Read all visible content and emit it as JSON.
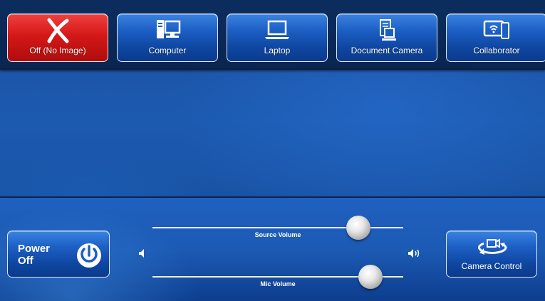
{
  "sources": [
    {
      "label": "Off (No Image)",
      "icon": "x-icon",
      "active": true
    },
    {
      "label": "Computer",
      "icon": "computer-icon",
      "active": false
    },
    {
      "label": "Laptop",
      "icon": "laptop-icon",
      "active": false
    },
    {
      "label": "Document Camera",
      "icon": "document-camera-icon",
      "active": false
    },
    {
      "label": "Collaborator",
      "icon": "collaborator-icon",
      "active": false
    }
  ],
  "power": {
    "label": "Power Off",
    "icon": "power-icon"
  },
  "camera": {
    "label": "Camera Control",
    "icon": "camera-rotate-icon"
  },
  "source_volume": {
    "label": "Source Volume",
    "level": 0.82
  },
  "mic_volume": {
    "label": "Mic Volume",
    "level": 0.87
  },
  "colors": {
    "active_source": "#d41818",
    "button_blue": "#1c5fc4",
    "background": "#1c5ab0"
  }
}
